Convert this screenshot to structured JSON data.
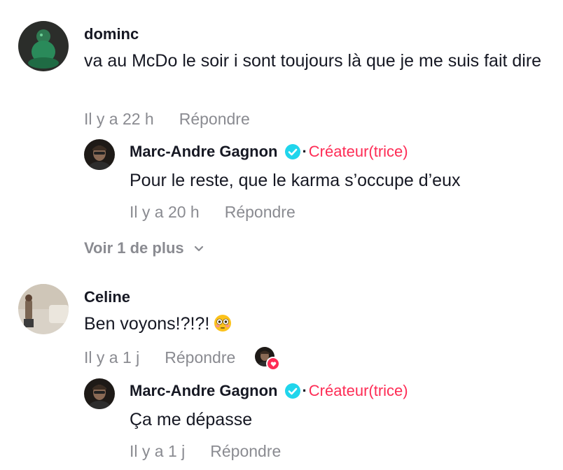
{
  "comments": [
    {
      "username": "dominc",
      "text": "va au McDo le soir i sont toujours là que je me suis fait dire",
      "time": "Il y a 22 h",
      "reply_label": "Répondre",
      "replies": [
        {
          "username": "Marc-Andre Gagnon",
          "badge_sep": "·",
          "badge_label": "Créateur(trice)",
          "text": "Pour le reste, que le karma s’occupe d’eux",
          "time": "Il y a 20 h",
          "reply_label": "Répondre"
        }
      ],
      "more_label": "Voir 1 de plus"
    },
    {
      "username": "Celine",
      "text": "Ben voyons!?!?!",
      "emoji": "flushed-face",
      "time": "Il y a 1 j",
      "reply_label": "Répondre",
      "liked_by_creator": true,
      "replies": [
        {
          "username": "Marc-Andre Gagnon",
          "badge_sep": "·",
          "badge_label": "Créateur(trice)",
          "text": "Ça me dépasse",
          "time": "Il y a 1 j",
          "reply_label": "Répondre"
        }
      ]
    }
  ],
  "colors": {
    "accent": "#fe2c55",
    "verified": "#20d5ec",
    "muted": "#8a8b91",
    "text": "#161823"
  }
}
